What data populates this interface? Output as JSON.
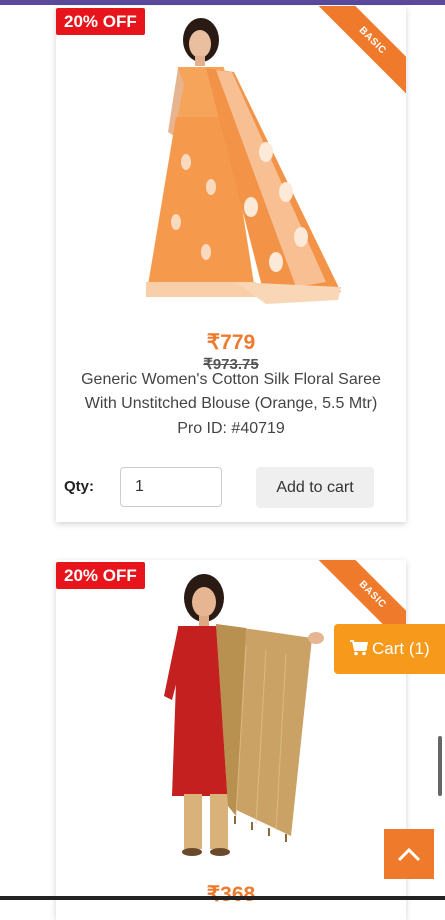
{
  "colors": {
    "accent": "#f07a2c",
    "discount": "#e8141b",
    "cart": "#f79a1c",
    "top_bar": "#5b4a9c"
  },
  "products": [
    {
      "discount": "20% OFF",
      "ribbon": "BASIC",
      "price": "₹779",
      "old_price": "₹973.75",
      "title": "Generic Women's Cotton Silk Floral Saree With Unstitched Blouse (Orange, 5.5 Mtr)",
      "pro_id": "Pro ID: #40719",
      "qty_label": "Qty:",
      "qty_value": "1",
      "add_to_cart": "Add to cart"
    },
    {
      "discount": "20% OFF",
      "ribbon": "BASIC",
      "price": "₹368"
    }
  ],
  "floating_cart": {
    "label": "Cart (1)",
    "icon": "cart-icon"
  },
  "scroll_up": {
    "icon": "chevron-up-icon"
  }
}
